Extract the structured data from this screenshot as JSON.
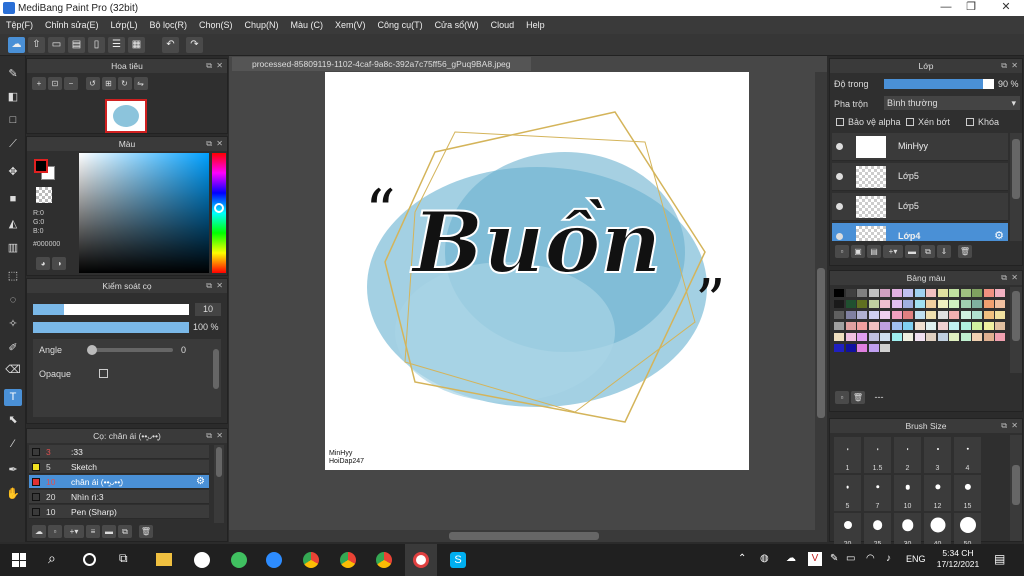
{
  "window": {
    "title": "MediBang Paint Pro (32bit)"
  },
  "menu": [
    "Tệp(F)",
    "Chỉnh sửa(E)",
    "Lớp(L)",
    "Bộ lọc(R)",
    "Chọn(S)",
    "Chụp(N)",
    "Màu (C)",
    "Xem(V)",
    "Công cụ(T)",
    "Cửa sổ(W)",
    "Cloud",
    "Help"
  ],
  "navigator": {
    "title": "Hoa tiêu"
  },
  "color_panel": {
    "title": "Màu",
    "r": "R:0",
    "g": "G:0",
    "b": "B:0",
    "hex": "#000000"
  },
  "brush_control": {
    "title": "Kiểm soát cọ",
    "size": "10",
    "opacity": "100 %",
    "angle_label": "Angle",
    "angle_value": "0",
    "opaque_label": "Opaque"
  },
  "brush_list": {
    "title": "Cọ: chân ái (••͈ᴗ••͈)",
    "items": [
      {
        "num": "3",
        "name": ":33",
        "color": "#3a3a3a"
      },
      {
        "num": "5",
        "name": "Sketch",
        "color": "#f0e020"
      },
      {
        "num": "10",
        "name": "chân ái (••͈ᴗ••͈)",
        "color": "#e03030"
      },
      {
        "num": "20",
        "name": "Nhìn rì:3",
        "color": "#3a3a3a"
      },
      {
        "num": "10",
        "name": "Pen (Sharp)",
        "color": "#3a3a3a"
      }
    ]
  },
  "document": {
    "tab": "processed-85809119-1102-4caf-9a8c-392a7c75ff56_gPuq9BA8.jpeg",
    "canvas_text": "Buồn",
    "signature_line1": "MinHyy",
    "signature_line2": "HoiDap247"
  },
  "layers": {
    "title": "Lớp",
    "opacity_label": "Độ trong",
    "opacity_value": "90 %",
    "blend_label": "Pha trộn",
    "blend_value": "Bình thường",
    "protect_alpha": "Bảo vệ alpha",
    "clipping": "Xén bớt",
    "lock": "Khóa",
    "items": [
      {
        "name": "MinHyy"
      },
      {
        "name": "Lớp5"
      },
      {
        "name": "Lớp5"
      },
      {
        "name": "Lớp4"
      }
    ]
  },
  "palette": {
    "title": "Bảng màu",
    "footer": "---",
    "colors": [
      "#000000",
      "#404040",
      "#808080",
      "#c0c0c0",
      "#d0a0c0",
      "#e0b0e0",
      "#c0c0f0",
      "#a0d0f0",
      "#f0c0c0",
      "#e0e0a0",
      "#c0e0a0",
      "#a0c080",
      "#80a060",
      "#f09080",
      "#f0b0c0",
      "#1a1a1a",
      "#205030",
      "#607020",
      "#c0d0a0",
      "#f0c0d0",
      "#e0c0f0",
      "#a0b0e0",
      "#a0e0f0",
      "#f0d0a0",
      "#f0f0c0",
      "#d0f0c0",
      "#a0d0b0",
      "#80b0a0",
      "#f0a070",
      "#f0c0a0",
      "#606060",
      "#8080a0",
      "#b0b0d0",
      "#d0d0f0",
      "#f0d0f0",
      "#f0a0c0",
      "#e08080",
      "#c0e0f0",
      "#f0e0b0",
      "#e0e0e0",
      "#f0b0b0",
      "#d0f0e0",
      "#b0e0d0",
      "#f0c080",
      "#f0e0a0",
      "#a0a0a0",
      "#e0a0a0",
      "#f0a0a0",
      "#f0c0c0",
      "#c0a0e0",
      "#a0c0f0",
      "#80d0f0",
      "#f0e0d0",
      "#e0f0f0",
      "#f0d0d0",
      "#c0f0f0",
      "#b0f0e0",
      "#d0f0a0",
      "#f0f0a0",
      "#e0c0a0",
      "#f0e0c0",
      "#f0c0e0",
      "#e0a0f0",
      "#c0c0e0",
      "#d0e0f0",
      "#a0f0f0",
      "#f0f0e0",
      "#f0e0f0",
      "#e0d0c0",
      "#c0d0e0",
      "#e0f0c0",
      "#c0f0d0",
      "#f0d0b0",
      "#e0b090",
      "#f0a0b0",
      "#2020c0",
      "#1010a0",
      "#e080e0",
      "#c0a0f0",
      "#d0d0d0"
    ]
  },
  "brush_size": {
    "title": "Brush Size",
    "sizes": [
      "1",
      "1.5",
      "2",
      "3",
      "4",
      "5",
      "7",
      "10",
      "12",
      "15",
      "20",
      "25",
      "30",
      "40",
      "50"
    ]
  },
  "taskbar": {
    "time": "5:34 CH",
    "date": "17/12/2021",
    "lang": "ENG"
  }
}
